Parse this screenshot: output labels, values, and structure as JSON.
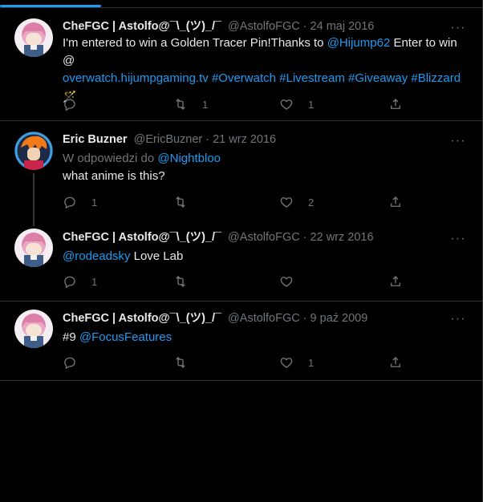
{
  "tweets": [
    {
      "name": "CheFGC | Astolfo@¯\\_(ツ)_/¯",
      "handle": "@AstolfoFGC",
      "date": "24 maj 2016",
      "text_a": "I'm entered to win a Golden Tracer Pin!Thanks to ",
      "mention": "@Hijump62",
      "text_b": " Enter to win @",
      "link": "overwatch.hijumpgaming.tv",
      "tags": "#Overwatch #Livestream #Giveaway #Blizzard",
      "emoji": "🪄",
      "reply_count": "",
      "retweet_count": "1",
      "like_count": "1"
    },
    {
      "name": "Eric Buzner",
      "handle": "@EricBuzner",
      "date": "21 wrz 2016",
      "reply_prefix": "W odpowiedzi do ",
      "reply_to": "@Nightbloo",
      "text": "what anime is this?",
      "reply_count": "1",
      "retweet_count": "",
      "like_count": "2"
    },
    {
      "name": "CheFGC | Astolfo@¯\\_(ツ)_/¯",
      "handle": "@AstolfoFGC",
      "date": "22 wrz 2016",
      "mention": "@rodeadsky",
      "text": " Love Lab",
      "reply_count": "1",
      "retweet_count": "",
      "like_count": ""
    },
    {
      "name": "CheFGC | Astolfo@¯\\_(ツ)_/¯",
      "handle": "@AstolfoFGC",
      "date": "9 paź 2009",
      "text": "#9 ",
      "mention": "@FocusFeatures",
      "reply_count": "",
      "retweet_count": "",
      "like_count": "1"
    }
  ],
  "ui": {
    "dot": "·",
    "more": "···"
  },
  "colors": {
    "background": "#000000",
    "text": "#e7e9ea",
    "muted": "#71767b",
    "link": "#1d9bf0",
    "border": "#2f3336"
  },
  "icons": [
    "reply-icon",
    "retweet-icon",
    "like-icon",
    "share-icon",
    "more-icon",
    "avatar"
  ]
}
